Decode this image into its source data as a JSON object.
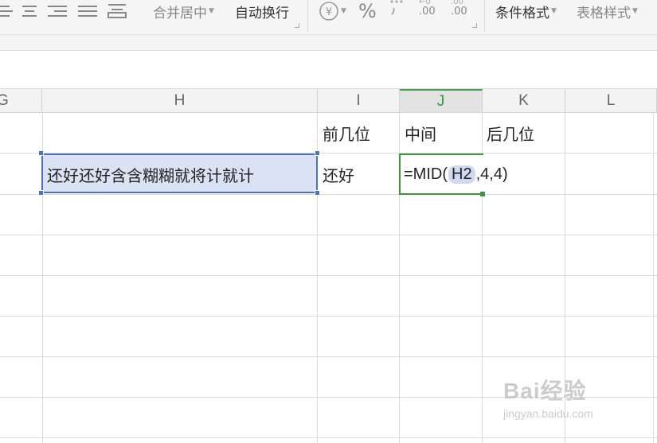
{
  "ribbon": {
    "merge_center": "合并居中",
    "wrap_text": "自动换行",
    "percent": "%",
    "increase_decimal": ".00",
    "decrease_decimal": ".00",
    "conditional_format": "条件格式",
    "table_style": "表格样式"
  },
  "columns": {
    "G": "G",
    "H": "H",
    "I": "I",
    "J": "J",
    "K": "K",
    "L": "L"
  },
  "cells": {
    "I1": "前几位",
    "J1": "中间",
    "K1": "后几位",
    "H2": "还好还好含含糊糊就将计就计",
    "I2": "还好"
  },
  "formula": {
    "prefix": "=MID(",
    "ref": "H2",
    "suffix": ",4,4)"
  },
  "watermark": {
    "brand": "Bai经验",
    "url": "jingyan.baidu.com"
  },
  "colors": {
    "selection_fill": "#dbe2f4",
    "selection_border": "#4b72c4",
    "active_border": "#3a9a3a",
    "ref_highlight": "#cfd9f0"
  }
}
